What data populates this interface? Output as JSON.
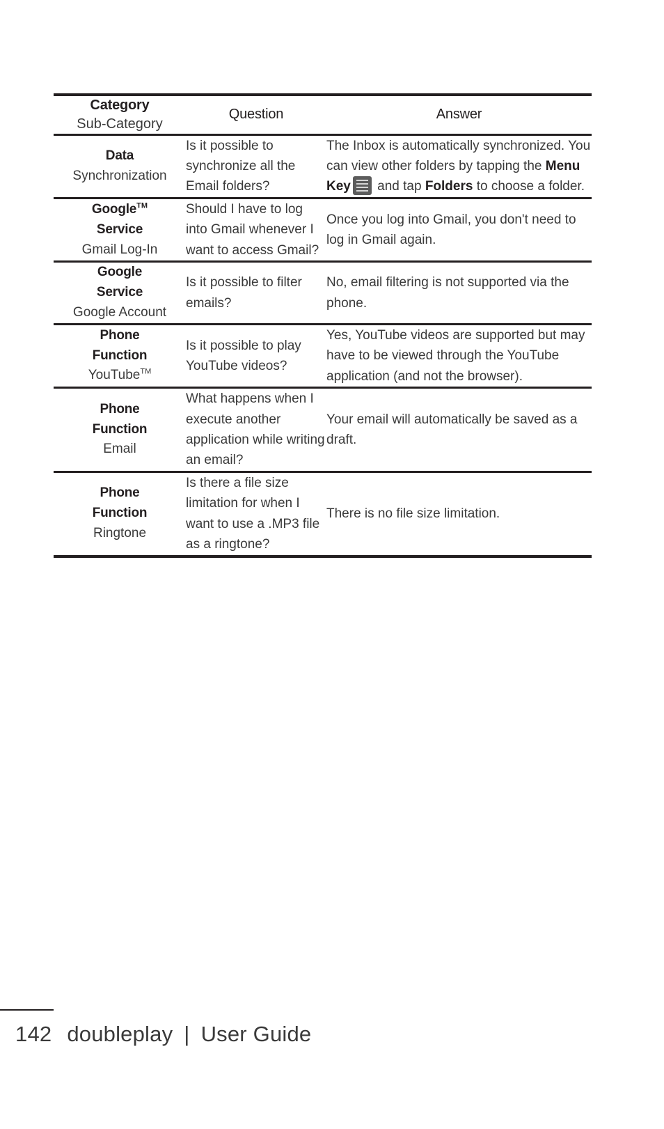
{
  "table": {
    "headers": {
      "category_main": "Category",
      "category_sub": "Sub-Category",
      "question": "Question",
      "answer": "Answer"
    },
    "rows": [
      {
        "category_main": "Data",
        "category_sub": "Synchronization",
        "question": "Is it possible to synchronize all the Email folders?",
        "answer_part1": "The Inbox is automatically synchronized. You can view other folders by tapping the ",
        "answer_bold1": "Menu Key",
        "answer_icon": "menu-key-icon",
        "answer_part2": " and tap ",
        "answer_bold2": "Folders",
        "answer_part3": "  to choose a folder."
      },
      {
        "category_main": "Google",
        "category_main_tm": "TM",
        "category_main2": "Service",
        "category_sub": "Gmail Log-In",
        "question": "Should I have to log into Gmail whenever I want to access Gmail?",
        "answer": "Once you log into Gmail, you don't need to log in Gmail again."
      },
      {
        "category_main": "Google",
        "category_main2": "Service",
        "category_sub": "Google Account",
        "question": "Is it possible to filter emails?",
        "answer": "No, email filtering is not supported via the phone."
      },
      {
        "category_main": "Phone",
        "category_main2": "Function",
        "category_sub": "YouTube",
        "category_sub_tm": "TM",
        "question": "Is it possible to play YouTube videos?",
        "answer": "Yes, YouTube videos are supported but may have to be viewed through the YouTube application (and not the browser)."
      },
      {
        "category_main": "Phone",
        "category_main2": "Function",
        "category_sub": "Email",
        "question": "What happens when I execute another application while writing an email?",
        "answer": "Your email will automatically be saved as a draft."
      },
      {
        "category_main": "Phone",
        "category_main2": "Function",
        "category_sub": "Ringtone",
        "question": "Is there a file size limitation for when I want to use a .MP3 file as a ringtone?",
        "answer": "There is no file size limitation."
      }
    ]
  },
  "footer": {
    "page_number": "142",
    "product": "doubleplay",
    "separator": "|",
    "doc_title": "User Guide"
  },
  "colors": {
    "rule": "#231f20",
    "text": "#3a3a3a",
    "bold_text": "#231f20",
    "icon_bg": "#5c5c5c",
    "icon_bars": "#d5d5d5"
  }
}
